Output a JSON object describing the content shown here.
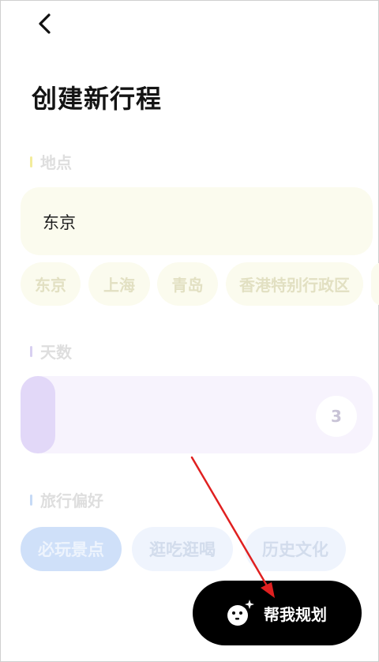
{
  "title": "创建新行程",
  "location": {
    "label": "地点",
    "value": "东京",
    "suggestions": [
      "东京",
      "上海",
      "青岛",
      "香港特别行政区"
    ]
  },
  "days": {
    "label": "天数",
    "value": "3",
    "slider_fraction": 0.1
  },
  "preferences": {
    "label": "旅行偏好",
    "options": [
      "必玩景点",
      "逛吃逛喝",
      "历史文化"
    ],
    "selected": "必玩景点"
  },
  "cta": {
    "label": "帮我规划"
  },
  "colors": {
    "location_accent": "#f3ec9c",
    "days_accent": "#d8d0f1",
    "preference_accent": "#c6daf6",
    "annotation_arrow": "#e02020"
  },
  "icons": {
    "back": "chevron-left-icon",
    "cta": "smiley-sparkle-icon"
  }
}
